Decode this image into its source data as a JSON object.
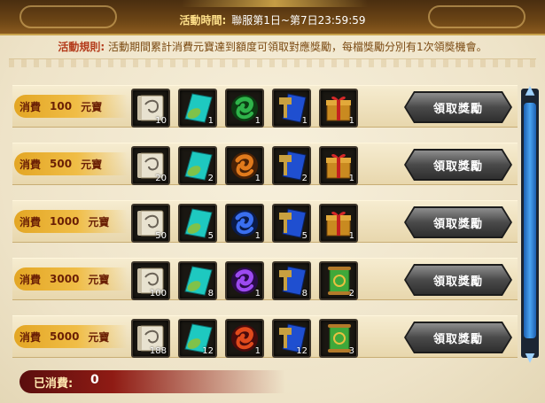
{
  "header": {
    "time_label": "活動時間:",
    "time_value": "聯服第1日~第7日23:59:59",
    "rule_label": "活動規則:",
    "rule_text": "活動期間累計消費元寶達到額度可領取對應獎勵，每檔獎勵分別有1次領獎機會。"
  },
  "rows": [
    {
      "label": "消費",
      "amount": "100",
      "unit": "元寶",
      "claim_label": "領取獎勵",
      "rewards": [
        {
          "icon": "scroll-icon",
          "count": "10"
        },
        {
          "icon": "teal-leaf-card-icon",
          "count": "1"
        },
        {
          "icon": "green-magatama-orb-icon",
          "count": "1"
        },
        {
          "icon": "blue-hammer-card-icon",
          "count": "1"
        },
        {
          "icon": "gift-box-icon",
          "count": "1"
        }
      ]
    },
    {
      "label": "消費",
      "amount": "500",
      "unit": "元寶",
      "claim_label": "領取獎勵",
      "rewards": [
        {
          "icon": "scroll-icon",
          "count": "20"
        },
        {
          "icon": "teal-leaf-card-icon",
          "count": "2"
        },
        {
          "icon": "orange-magatama-orb-icon",
          "count": "1"
        },
        {
          "icon": "blue-hammer-card-icon",
          "count": "2"
        },
        {
          "icon": "gift-box-icon",
          "count": "1"
        }
      ]
    },
    {
      "label": "消費",
      "amount": "1000",
      "unit": "元寶",
      "claim_label": "領取獎勵",
      "rewards": [
        {
          "icon": "scroll-icon",
          "count": "50"
        },
        {
          "icon": "teal-leaf-card-icon",
          "count": "5"
        },
        {
          "icon": "blue-magatama-orb-icon",
          "count": "1"
        },
        {
          "icon": "blue-hammer-card-icon",
          "count": "5"
        },
        {
          "icon": "gift-box-icon",
          "count": "1"
        }
      ]
    },
    {
      "label": "消費",
      "amount": "3000",
      "unit": "元寶",
      "claim_label": "領取獎勵",
      "rewards": [
        {
          "icon": "scroll-icon",
          "count": "100"
        },
        {
          "icon": "teal-leaf-card-icon",
          "count": "8"
        },
        {
          "icon": "purple-magatama-orb-icon",
          "count": "1"
        },
        {
          "icon": "blue-hammer-card-icon",
          "count": "8"
        },
        {
          "icon": "green-summon-scroll-icon",
          "count": "2"
        }
      ]
    },
    {
      "label": "消費",
      "amount": "5000",
      "unit": "元寶",
      "claim_label": "領取獎勵",
      "rewards": [
        {
          "icon": "scroll-icon",
          "count": "188"
        },
        {
          "icon": "teal-leaf-card-icon",
          "count": "12"
        },
        {
          "icon": "red-magatama-orb-icon",
          "count": "1"
        },
        {
          "icon": "blue-hammer-card-icon",
          "count": "12"
        },
        {
          "icon": "green-summon-scroll-icon",
          "count": "3"
        }
      ]
    }
  ],
  "footer": {
    "spent_label": "已消費",
    "spent_colon": ":",
    "spent_value": "0"
  },
  "colors": {
    "tier_gold": "#f0bd46",
    "claim_button": "#4a4a4a",
    "scroll_thumb": "#4aa3f0",
    "spent_bar": "#8f1b14"
  }
}
